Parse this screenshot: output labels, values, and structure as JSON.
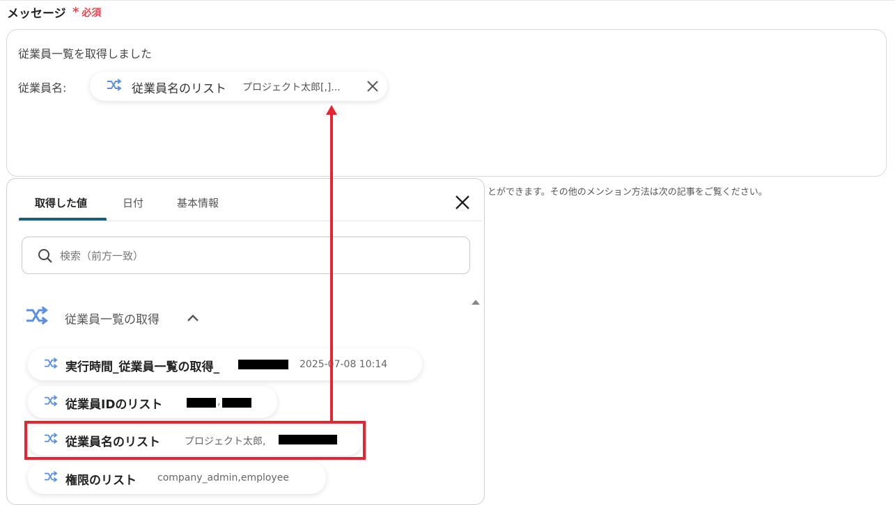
{
  "field": {
    "label": "メッセージ",
    "required_star": "*",
    "required_text": "必須"
  },
  "message": {
    "line1": "従業員一覧を取得しました",
    "line2_label": "従業員名:",
    "chip": {
      "icon": "shuffle-arrows-icon",
      "name": "従業員名のリスト",
      "preview": "プロジェクト太郎[,]..."
    }
  },
  "help_text": "とができます。その他のメンション方法は次の記事をご覧ください。",
  "picker": {
    "tabs": [
      {
        "label": "取得した値",
        "active": true
      },
      {
        "label": "日付",
        "active": false
      },
      {
        "label": "基本情報",
        "active": false
      }
    ],
    "search": {
      "placeholder": "検索（前方一致）",
      "value": ""
    },
    "section": {
      "title": "従業員一覧の取得",
      "expanded": true
    },
    "items": [
      {
        "name": "実行時間_従業員一覧の取得_",
        "value": "2025-07-08 10:14",
        "redacted": true
      },
      {
        "name": "従業員IDのリスト",
        "value": ",",
        "redacted": true
      },
      {
        "name": "従業員名のリスト",
        "value": "プロジェクト太郎,",
        "redacted": true,
        "highlighted": true
      },
      {
        "name": "権限のリスト",
        "value": "company_admin,employee",
        "redacted": false
      }
    ]
  },
  "colors": {
    "accent_tab": "#1b5e7a",
    "required": "#e5484d",
    "annotation_red": "#e52530",
    "icon_blue": "#5b8fe0"
  }
}
